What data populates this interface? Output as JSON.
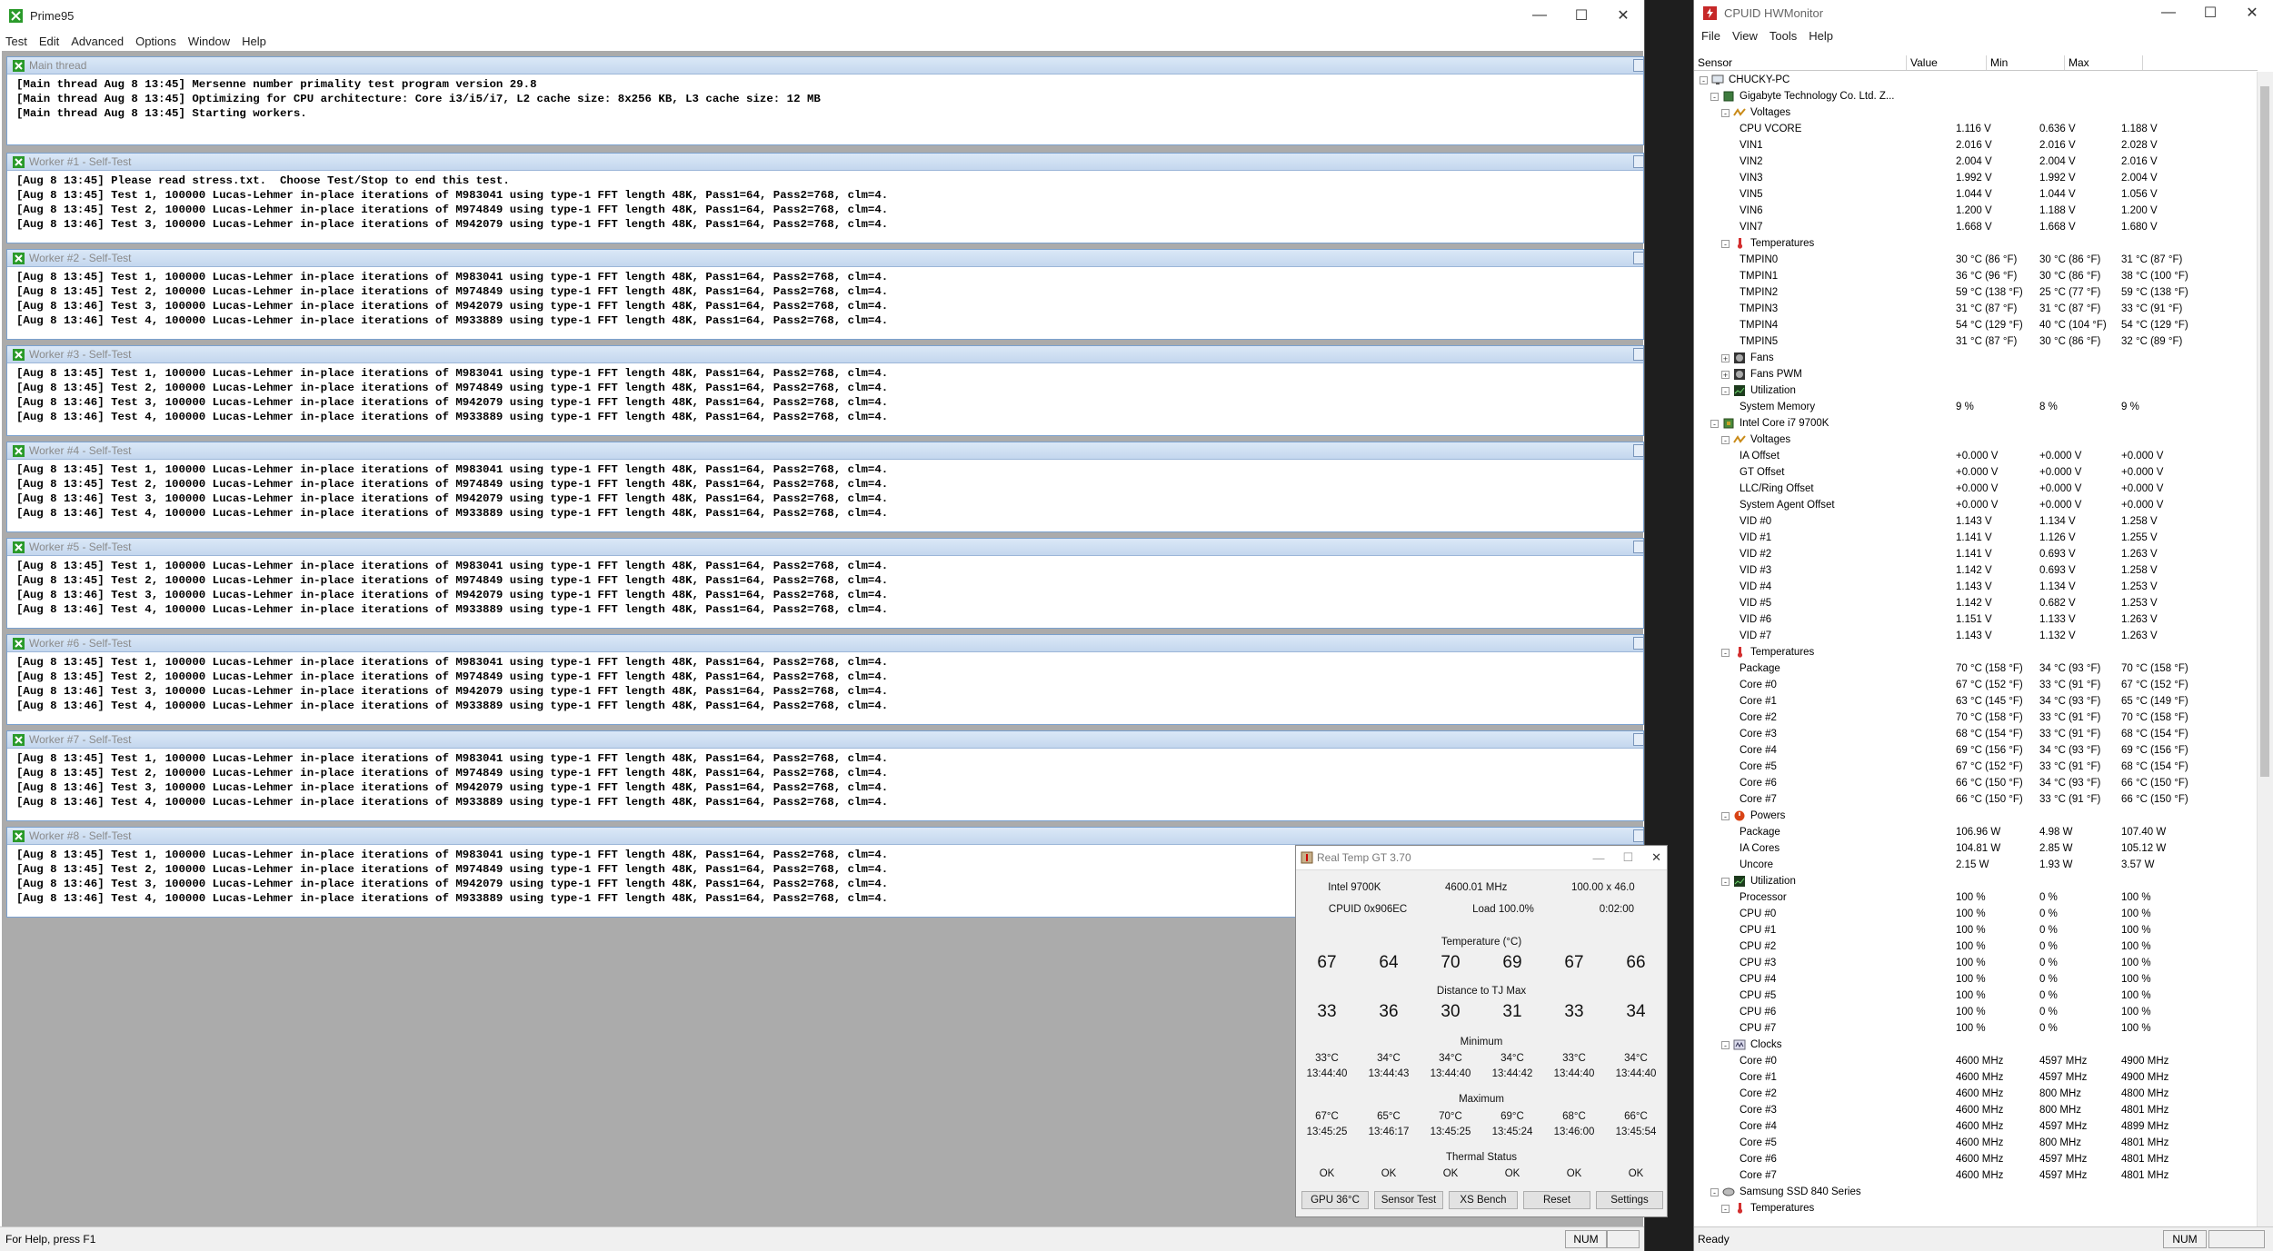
{
  "prime95": {
    "title": "Prime95",
    "menu": [
      "Test",
      "Edit",
      "Advanced",
      "Options",
      "Window",
      "Help"
    ],
    "status_text": "For Help, press F1",
    "status_num": "NUM",
    "main_thread": {
      "title": "Main thread",
      "lines": [
        "[Main thread Aug 8 13:45] Mersenne number primality test program version 29.8",
        "[Main thread Aug 8 13:45] Optimizing for CPU architecture: Core i3/i5/i7, L2 cache size: 8x256 KB, L3 cache size: 12 MB",
        "[Main thread Aug 8 13:45] Starting workers."
      ]
    },
    "workers": [
      {
        "title": "Worker #1 - Self-Test",
        "lines": [
          "[Aug 8 13:45] Please read stress.txt.  Choose Test/Stop to end this test.",
          "[Aug 8 13:45] Test 1, 100000 Lucas-Lehmer in-place iterations of M983041 using type-1 FFT length 48K, Pass1=64, Pass2=768, clm=4.",
          "[Aug 8 13:45] Test 2, 100000 Lucas-Lehmer in-place iterations of M974849 using type-1 FFT length 48K, Pass1=64, Pass2=768, clm=4.",
          "[Aug 8 13:46] Test 3, 100000 Lucas-Lehmer in-place iterations of M942079 using type-1 FFT length 48K, Pass1=64, Pass2=768, clm=4."
        ]
      },
      {
        "title": "Worker #2 - Self-Test",
        "lines": [
          "[Aug 8 13:45] Test 1, 100000 Lucas-Lehmer in-place iterations of M983041 using type-1 FFT length 48K, Pass1=64, Pass2=768, clm=4.",
          "[Aug 8 13:45] Test 2, 100000 Lucas-Lehmer in-place iterations of M974849 using type-1 FFT length 48K, Pass1=64, Pass2=768, clm=4.",
          "[Aug 8 13:46] Test 3, 100000 Lucas-Lehmer in-place iterations of M942079 using type-1 FFT length 48K, Pass1=64, Pass2=768, clm=4.",
          "[Aug 8 13:46] Test 4, 100000 Lucas-Lehmer in-place iterations of M933889 using type-1 FFT length 48K, Pass1=64, Pass2=768, clm=4."
        ]
      },
      {
        "title": "Worker #3 - Self-Test",
        "lines": [
          "[Aug 8 13:45] Test 1, 100000 Lucas-Lehmer in-place iterations of M983041 using type-1 FFT length 48K, Pass1=64, Pass2=768, clm=4.",
          "[Aug 8 13:45] Test 2, 100000 Lucas-Lehmer in-place iterations of M974849 using type-1 FFT length 48K, Pass1=64, Pass2=768, clm=4.",
          "[Aug 8 13:46] Test 3, 100000 Lucas-Lehmer in-place iterations of M942079 using type-1 FFT length 48K, Pass1=64, Pass2=768, clm=4.",
          "[Aug 8 13:46] Test 4, 100000 Lucas-Lehmer in-place iterations of M933889 using type-1 FFT length 48K, Pass1=64, Pass2=768, clm=4."
        ]
      },
      {
        "title": "Worker #4 - Self-Test",
        "lines": [
          "[Aug 8 13:45] Test 1, 100000 Lucas-Lehmer in-place iterations of M983041 using type-1 FFT length 48K, Pass1=64, Pass2=768, clm=4.",
          "[Aug 8 13:45] Test 2, 100000 Lucas-Lehmer in-place iterations of M974849 using type-1 FFT length 48K, Pass1=64, Pass2=768, clm=4.",
          "[Aug 8 13:46] Test 3, 100000 Lucas-Lehmer in-place iterations of M942079 using type-1 FFT length 48K, Pass1=64, Pass2=768, clm=4.",
          "[Aug 8 13:46] Test 4, 100000 Lucas-Lehmer in-place iterations of M933889 using type-1 FFT length 48K, Pass1=64, Pass2=768, clm=4."
        ]
      },
      {
        "title": "Worker #5 - Self-Test",
        "lines": [
          "[Aug 8 13:45] Test 1, 100000 Lucas-Lehmer in-place iterations of M983041 using type-1 FFT length 48K, Pass1=64, Pass2=768, clm=4.",
          "[Aug 8 13:45] Test 2, 100000 Lucas-Lehmer in-place iterations of M974849 using type-1 FFT length 48K, Pass1=64, Pass2=768, clm=4.",
          "[Aug 8 13:46] Test 3, 100000 Lucas-Lehmer in-place iterations of M942079 using type-1 FFT length 48K, Pass1=64, Pass2=768, clm=4.",
          "[Aug 8 13:46] Test 4, 100000 Lucas-Lehmer in-place iterations of M933889 using type-1 FFT length 48K, Pass1=64, Pass2=768, clm=4."
        ]
      },
      {
        "title": "Worker #6 - Self-Test",
        "lines": [
          "[Aug 8 13:45] Test 1, 100000 Lucas-Lehmer in-place iterations of M983041 using type-1 FFT length 48K, Pass1=64, Pass2=768, clm=4.",
          "[Aug 8 13:45] Test 2, 100000 Lucas-Lehmer in-place iterations of M974849 using type-1 FFT length 48K, Pass1=64, Pass2=768, clm=4.",
          "[Aug 8 13:46] Test 3, 100000 Lucas-Lehmer in-place iterations of M942079 using type-1 FFT length 48K, Pass1=64, Pass2=768, clm=4.",
          "[Aug 8 13:46] Test 4, 100000 Lucas-Lehmer in-place iterations of M933889 using type-1 FFT length 48K, Pass1=64, Pass2=768, clm=4."
        ]
      },
      {
        "title": "Worker #7 - Self-Test",
        "lines": [
          "[Aug 8 13:45] Test 1, 100000 Lucas-Lehmer in-place iterations of M983041 using type-1 FFT length 48K, Pass1=64, Pass2=768, clm=4.",
          "[Aug 8 13:45] Test 2, 100000 Lucas-Lehmer in-place iterations of M974849 using type-1 FFT length 48K, Pass1=64, Pass2=768, clm=4.",
          "[Aug 8 13:46] Test 3, 100000 Lucas-Lehmer in-place iterations of M942079 using type-1 FFT length 48K, Pass1=64, Pass2=768, clm=4.",
          "[Aug 8 13:46] Test 4, 100000 Lucas-Lehmer in-place iterations of M933889 using type-1 FFT length 48K, Pass1=64, Pass2=768, clm=4."
        ]
      },
      {
        "title": "Worker #8 - Self-Test",
        "lines": [
          "[Aug 8 13:45] Test 1, 100000 Lucas-Lehmer in-place iterations of M983041 using type-1 FFT length 48K, Pass1=64, Pass2=768, clm=4.",
          "[Aug 8 13:45] Test 2, 100000 Lucas-Lehmer in-place iterations of M974849 using type-1 FFT length 48K, Pass1=64, Pass2=768, clm=4.",
          "[Aug 8 13:46] Test 3, 100000 Lucas-Lehmer in-place iterations of M942079 using type-1 FFT length 48K, Pass1=64, Pass2=768, clm=4.",
          "[Aug 8 13:46] Test 4, 100000 Lucas-Lehmer in-place iterations of M933889 using type-1 FFT length 48K, Pass1=64, Pass2=768, clm=4."
        ]
      }
    ]
  },
  "realtemp": {
    "title": "Real Temp GT 3.70",
    "cpu": "Intel 9700K",
    "freq": "4600.01 MHz",
    "multiplier": "100.00 x 46.0",
    "cpuid": "CPUID  0x906EC",
    "load": "Load 100.0%",
    "elapsed": "0:02:00",
    "temp_label": "Temperature (°C)",
    "temps": [
      "67",
      "64",
      "70",
      "69",
      "67",
      "66"
    ],
    "dist_label": "Distance to TJ Max",
    "dist": [
      "33",
      "36",
      "30",
      "31",
      "33",
      "34"
    ],
    "min_label": "Minimum",
    "min_vals": [
      "33°C",
      "34°C",
      "34°C",
      "34°C",
      "33°C",
      "34°C"
    ],
    "min_times": [
      "13:44:40",
      "13:44:43",
      "13:44:40",
      "13:44:42",
      "13:44:40",
      "13:44:40"
    ],
    "max_label": "Maximum",
    "max_vals": [
      "67°C",
      "65°C",
      "70°C",
      "69°C",
      "68°C",
      "66°C"
    ],
    "max_times": [
      "13:45:25",
      "13:46:17",
      "13:45:25",
      "13:45:24",
      "13:46:00",
      "13:45:54"
    ],
    "thermal_label": "Thermal Status",
    "thermal": [
      "OK",
      "OK",
      "OK",
      "OK",
      "OK",
      "OK"
    ],
    "buttons": [
      "GPU  36°C",
      "Sensor Test",
      "XS Bench",
      "Reset",
      "Settings"
    ]
  },
  "hwmonitor": {
    "title": "CPUID HWMonitor",
    "menu": [
      "File",
      "View",
      "Tools",
      "Help"
    ],
    "columns": [
      "Sensor",
      "Value",
      "Min",
      "Max"
    ],
    "status": "Ready",
    "status_num": "NUM",
    "rows": [
      {
        "level": 0,
        "exp": "-",
        "icon": "computer-icon",
        "label": "CHUCKY-PC"
      },
      {
        "level": 1,
        "exp": "-",
        "icon": "chip-icon",
        "label": "Gigabyte Technology Co. Ltd. Z..."
      },
      {
        "level": 2,
        "exp": "-",
        "icon": "voltage-icon",
        "label": "Voltages"
      },
      {
        "level": 3,
        "label": "CPU VCORE",
        "value": "1.116 V",
        "min": "0.636 V",
        "max": "1.188 V"
      },
      {
        "level": 3,
        "label": "VIN1",
        "value": "2.016 V",
        "min": "2.016 V",
        "max": "2.028 V"
      },
      {
        "level": 3,
        "label": "VIN2",
        "value": "2.004 V",
        "min": "2.004 V",
        "max": "2.016 V"
      },
      {
        "level": 3,
        "label": "VIN3",
        "value": "1.992 V",
        "min": "1.992 V",
        "max": "2.004 V"
      },
      {
        "level": 3,
        "label": "VIN5",
        "value": "1.044 V",
        "min": "1.044 V",
        "max": "1.056 V"
      },
      {
        "level": 3,
        "label": "VIN6",
        "value": "1.200 V",
        "min": "1.188 V",
        "max": "1.200 V"
      },
      {
        "level": 3,
        "label": "VIN7",
        "value": "1.668 V",
        "min": "1.668 V",
        "max": "1.680 V"
      },
      {
        "level": 2,
        "exp": "-",
        "icon": "thermometer-icon",
        "label": "Temperatures"
      },
      {
        "level": 3,
        "label": "TMPIN0",
        "value": "30 °C  (86 °F)",
        "min": "30 °C  (86 °F)",
        "max": "31 °C  (87 °F)"
      },
      {
        "level": 3,
        "label": "TMPIN1",
        "value": "36 °C  (96 °F)",
        "min": "30 °C  (86 °F)",
        "max": "38 °C  (100 °F)"
      },
      {
        "level": 3,
        "label": "TMPIN2",
        "value": "59 °C  (138 °F)",
        "min": "25 °C  (77 °F)",
        "max": "59 °C  (138 °F)"
      },
      {
        "level": 3,
        "label": "TMPIN3",
        "value": "31 °C  (87 °F)",
        "min": "31 °C  (87 °F)",
        "max": "33 °C  (91 °F)"
      },
      {
        "level": 3,
        "label": "TMPIN4",
        "value": "54 °C  (129 °F)",
        "min": "40 °C  (104 °F)",
        "max": "54 °C  (129 °F)"
      },
      {
        "level": 3,
        "label": "TMPIN5",
        "value": "31 °C  (87 °F)",
        "min": "30 °C  (86 °F)",
        "max": "32 °C  (89 °F)"
      },
      {
        "level": 2,
        "exp": "+",
        "icon": "fan-icon",
        "label": "Fans"
      },
      {
        "level": 2,
        "exp": "+",
        "icon": "fan-icon",
        "label": "Fans PWM"
      },
      {
        "level": 2,
        "exp": "-",
        "icon": "utilization-icon",
        "label": "Utilization"
      },
      {
        "level": 3,
        "label": "System Memory",
        "value": "9 %",
        "min": "8 %",
        "max": "9 %"
      },
      {
        "level": 1,
        "exp": "-",
        "icon": "cpu-icon",
        "label": "Intel Core i7 9700K"
      },
      {
        "level": 2,
        "exp": "-",
        "icon": "voltage-icon",
        "label": "Voltages"
      },
      {
        "level": 3,
        "label": "IA Offset",
        "value": "+0.000 V",
        "min": "+0.000 V",
        "max": "+0.000 V"
      },
      {
        "level": 3,
        "label": "GT Offset",
        "value": "+0.000 V",
        "min": "+0.000 V",
        "max": "+0.000 V"
      },
      {
        "level": 3,
        "label": "LLC/Ring Offset",
        "value": "+0.000 V",
        "min": "+0.000 V",
        "max": "+0.000 V"
      },
      {
        "level": 3,
        "label": "System Agent Offset",
        "value": "+0.000 V",
        "min": "+0.000 V",
        "max": "+0.000 V"
      },
      {
        "level": 3,
        "label": "VID #0",
        "value": "1.143 V",
        "min": "1.134 V",
        "max": "1.258 V"
      },
      {
        "level": 3,
        "label": "VID #1",
        "value": "1.141 V",
        "min": "1.126 V",
        "max": "1.255 V"
      },
      {
        "level": 3,
        "label": "VID #2",
        "value": "1.141 V",
        "min": "0.693 V",
        "max": "1.263 V"
      },
      {
        "level": 3,
        "label": "VID #3",
        "value": "1.142 V",
        "min": "0.693 V",
        "max": "1.258 V"
      },
      {
        "level": 3,
        "label": "VID #4",
        "value": "1.143 V",
        "min": "1.134 V",
        "max": "1.253 V"
      },
      {
        "level": 3,
        "label": "VID #5",
        "value": "1.142 V",
        "min": "0.682 V",
        "max": "1.253 V"
      },
      {
        "level": 3,
        "label": "VID #6",
        "value": "1.151 V",
        "min": "1.133 V",
        "max": "1.263 V"
      },
      {
        "level": 3,
        "label": "VID #7",
        "value": "1.143 V",
        "min": "1.132 V",
        "max": "1.263 V"
      },
      {
        "level": 2,
        "exp": "-",
        "icon": "thermometer-icon",
        "label": "Temperatures"
      },
      {
        "level": 3,
        "label": "Package",
        "value": "70 °C  (158 °F)",
        "min": "34 °C  (93 °F)",
        "max": "70 °C  (158 °F)"
      },
      {
        "level": 3,
        "label": "Core #0",
        "value": "67 °C  (152 °F)",
        "min": "33 °C  (91 °F)",
        "max": "67 °C  (152 °F)"
      },
      {
        "level": 3,
        "label": "Core #1",
        "value": "63 °C  (145 °F)",
        "min": "34 °C  (93 °F)",
        "max": "65 °C  (149 °F)"
      },
      {
        "level": 3,
        "label": "Core #2",
        "value": "70 °C  (158 °F)",
        "min": "33 °C  (91 °F)",
        "max": "70 °C  (158 °F)"
      },
      {
        "level": 3,
        "label": "Core #3",
        "value": "68 °C  (154 °F)",
        "min": "33 °C  (91 °F)",
        "max": "68 °C  (154 °F)"
      },
      {
        "level": 3,
        "label": "Core #4",
        "value": "69 °C  (156 °F)",
        "min": "34 °C  (93 °F)",
        "max": "69 °C  (156 °F)"
      },
      {
        "level": 3,
        "label": "Core #5",
        "value": "67 °C  (152 °F)",
        "min": "33 °C  (91 °F)",
        "max": "68 °C  (154 °F)"
      },
      {
        "level": 3,
        "label": "Core #6",
        "value": "66 °C  (150 °F)",
        "min": "34 °C  (93 °F)",
        "max": "66 °C  (150 °F)"
      },
      {
        "level": 3,
        "label": "Core #7",
        "value": "66 °C  (150 °F)",
        "min": "33 °C  (91 °F)",
        "max": "66 °C  (150 °F)"
      },
      {
        "level": 2,
        "exp": "-",
        "icon": "power-icon",
        "label": "Powers"
      },
      {
        "level": 3,
        "label": "Package",
        "value": "106.96 W",
        "min": "4.98 W",
        "max": "107.40 W"
      },
      {
        "level": 3,
        "label": "IA Cores",
        "value": "104.81 W",
        "min": "2.85 W",
        "max": "105.12 W"
      },
      {
        "level": 3,
        "label": "Uncore",
        "value": "2.15 W",
        "min": "1.93 W",
        "max": "3.57 W"
      },
      {
        "level": 2,
        "exp": "-",
        "icon": "utilization-icon",
        "label": "Utilization"
      },
      {
        "level": 3,
        "label": "Processor",
        "value": "100 %",
        "min": "0 %",
        "max": "100 %"
      },
      {
        "level": 3,
        "label": "CPU #0",
        "value": "100 %",
        "min": "0 %",
        "max": "100 %"
      },
      {
        "level": 3,
        "label": "CPU #1",
        "value": "100 %",
        "min": "0 %",
        "max": "100 %"
      },
      {
        "level": 3,
        "label": "CPU #2",
        "value": "100 %",
        "min": "0 %",
        "max": "100 %"
      },
      {
        "level": 3,
        "label": "CPU #3",
        "value": "100 %",
        "min": "0 %",
        "max": "100 %"
      },
      {
        "level": 3,
        "label": "CPU #4",
        "value": "100 %",
        "min": "0 %",
        "max": "100 %"
      },
      {
        "level": 3,
        "label": "CPU #5",
        "value": "100 %",
        "min": "0 %",
        "max": "100 %"
      },
      {
        "level": 3,
        "label": "CPU #6",
        "value": "100 %",
        "min": "0 %",
        "max": "100 %"
      },
      {
        "level": 3,
        "label": "CPU #7",
        "value": "100 %",
        "min": "0 %",
        "max": "100 %"
      },
      {
        "level": 2,
        "exp": "-",
        "icon": "clock-icon",
        "label": "Clocks"
      },
      {
        "level": 3,
        "label": "Core #0",
        "value": "4600 MHz",
        "min": "4597 MHz",
        "max": "4900 MHz"
      },
      {
        "level": 3,
        "label": "Core #1",
        "value": "4600 MHz",
        "min": "4597 MHz",
        "max": "4900 MHz"
      },
      {
        "level": 3,
        "label": "Core #2",
        "value": "4600 MHz",
        "min": "800 MHz",
        "max": "4800 MHz"
      },
      {
        "level": 3,
        "label": "Core #3",
        "value": "4600 MHz",
        "min": "800 MHz",
        "max": "4801 MHz"
      },
      {
        "level": 3,
        "label": "Core #4",
        "value": "4600 MHz",
        "min": "4597 MHz",
        "max": "4899 MHz"
      },
      {
        "level": 3,
        "label": "Core #5",
        "value": "4600 MHz",
        "min": "800 MHz",
        "max": "4801 MHz"
      },
      {
        "level": 3,
        "label": "Core #6",
        "value": "4600 MHz",
        "min": "4597 MHz",
        "max": "4801 MHz"
      },
      {
        "level": 3,
        "label": "Core #7",
        "value": "4600 MHz",
        "min": "4597 MHz",
        "max": "4801 MHz"
      },
      {
        "level": 1,
        "exp": "-",
        "icon": "disk-icon",
        "label": "Samsung SSD 840 Series"
      },
      {
        "level": 2,
        "exp": "-",
        "icon": "thermometer-icon",
        "label": "Temperatures"
      }
    ]
  }
}
